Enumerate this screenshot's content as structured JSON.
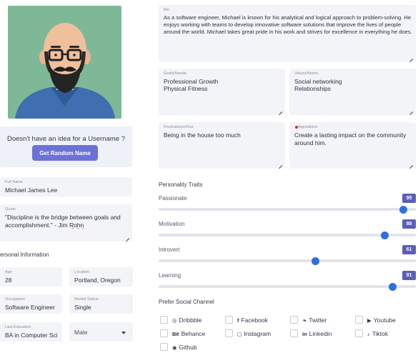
{
  "username_helper": {
    "message": "Doesn't have an idea for a Username ?",
    "button_label": "Get Random Name"
  },
  "fields": {
    "full_name": {
      "label": "Full Name",
      "value": "Michael James Lee"
    },
    "quote": {
      "label": "Quote",
      "value_start": "\"Discipline is the bridge between goals and accomplishment.\" - Jim ",
      "value_end": "Rohn"
    },
    "age": {
      "label": "Age",
      "value": "28"
    },
    "location": {
      "label": "Location",
      "value": "Portland, Oregon"
    },
    "occupation": {
      "label": "Occupation",
      "value": "Software Engineer"
    },
    "marital_status": {
      "label": "Marital Status",
      "value": "Single"
    },
    "last_education": {
      "label": "Last Education",
      "value": "BA in Computer Sci"
    },
    "gender_select": {
      "value": "Male"
    }
  },
  "personal_information_title": "ersonal Information",
  "bio": {
    "label": "Bio",
    "value": "As a software engineer, Michael is known for his analytical and logical approach to problem-solving. He enjoys working with teams to develop innovative software solutions that improve the lives of people around the world. Michael takes great pride in his work and strives for excellence in everything he does."
  },
  "goals": {
    "label": "Goals/Needs",
    "line1": "Professional Growth",
    "line2": "Physical Fitness"
  },
  "values": {
    "label": "Values/Wants",
    "line1": "Social networking",
    "line2": "Relationships"
  },
  "frustrations": {
    "label": "Frustrations/Fear",
    "value": "Being in the house too much"
  },
  "aspirations": {
    "label": "Aspirations",
    "value": "Create a lasting impact on the community around him."
  },
  "personality": {
    "title": "Personality Traits",
    "traits": [
      {
        "label": "Passionate",
        "value": 95
      },
      {
        "label": "Motivation",
        "value": 88
      },
      {
        "label": "Introvert",
        "value": 61
      },
      {
        "label": "Learning",
        "value": 91
      }
    ]
  },
  "social": {
    "title": "Prefer Social Channel",
    "channels": [
      {
        "label": "Dribbble",
        "icon": "dribbble-icon"
      },
      {
        "label": "Facebook",
        "icon": "facebook-icon"
      },
      {
        "label": "Twitter",
        "icon": "twitter-icon"
      },
      {
        "label": "Youtube",
        "icon": "youtube-icon"
      },
      {
        "label": "Behance",
        "icon": "behance-icon"
      },
      {
        "label": "Instagram",
        "icon": "instagram-icon"
      },
      {
        "label": "Linkedin",
        "icon": "linkedin-icon"
      },
      {
        "label": "Tiktok",
        "icon": "tiktok-icon"
      },
      {
        "label": "Github",
        "icon": "github-icon"
      }
    ]
  },
  "colors": {
    "accent": "#6c72d4",
    "badge": "#5b5fb8",
    "slider_thumb": "#2f6fe0",
    "avatar_bg": "#7fb896",
    "field_bg": "#f3f4f7"
  }
}
